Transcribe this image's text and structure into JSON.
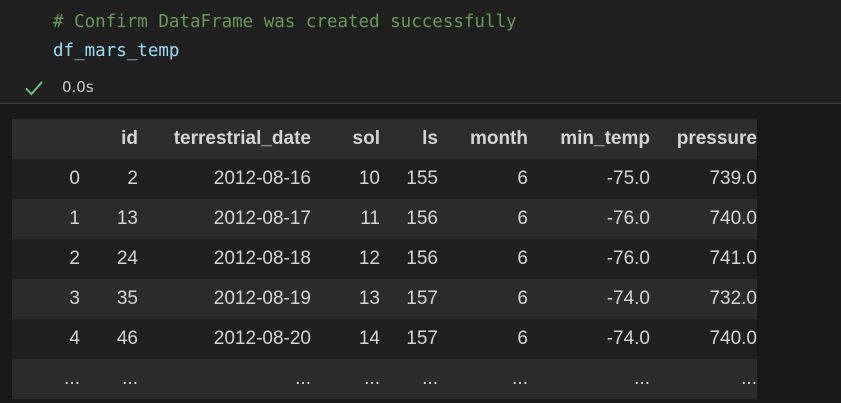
{
  "code": {
    "comment": "# Confirm DataFrame was created successfully",
    "variable": "df_mars_temp"
  },
  "status": {
    "icon": "check-icon",
    "elapsed": "0.0s",
    "color": "#73c991"
  },
  "table": {
    "columns": [
      "",
      "id",
      "terrestrial_date",
      "sol",
      "ls",
      "month",
      "min_temp",
      "pressure"
    ],
    "rows": [
      [
        "0",
        "2",
        "2012-08-16",
        "10",
        "155",
        "6",
        "-75.0",
        "739.0"
      ],
      [
        "1",
        "13",
        "2012-08-17",
        "11",
        "156",
        "6",
        "-76.0",
        "740.0"
      ],
      [
        "2",
        "24",
        "2012-08-18",
        "12",
        "156",
        "6",
        "-76.0",
        "741.0"
      ],
      [
        "3",
        "35",
        "2012-08-19",
        "13",
        "157",
        "6",
        "-74.0",
        "732.0"
      ],
      [
        "4",
        "46",
        "2012-08-20",
        "14",
        "157",
        "6",
        "-74.0",
        "740.0"
      ],
      [
        "...",
        "...",
        "...",
        "...",
        "...",
        "...",
        "...",
        "..."
      ]
    ]
  }
}
